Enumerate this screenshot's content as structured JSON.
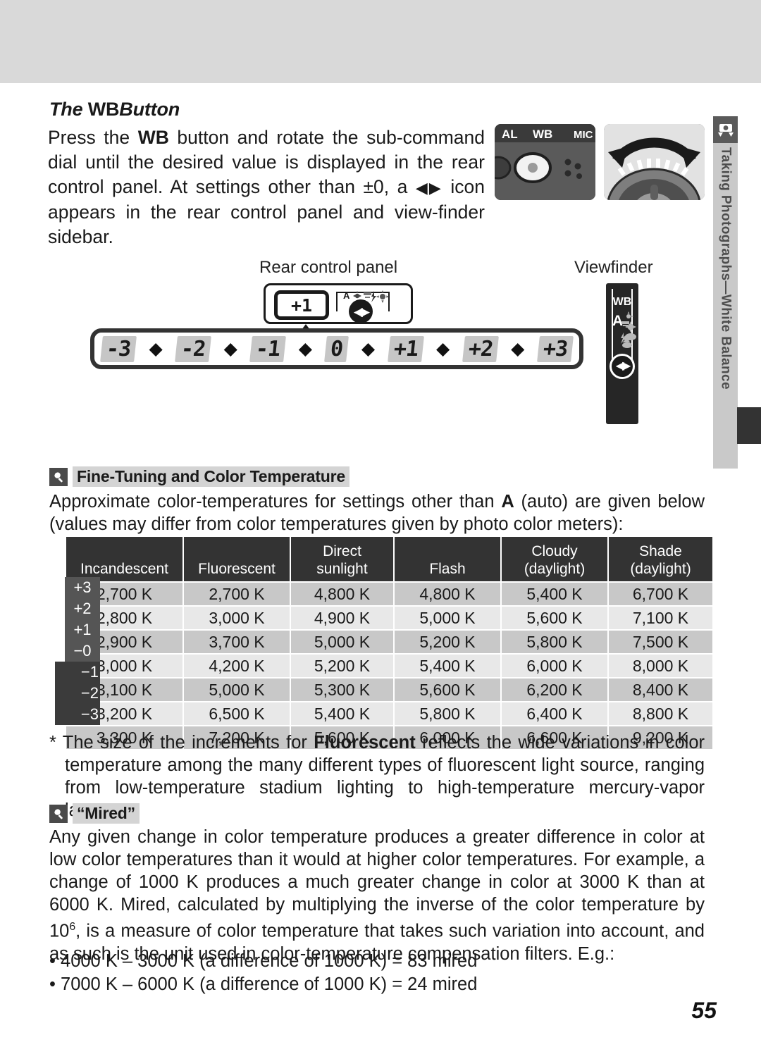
{
  "section_tab": {
    "label": "Taking Photographs—White Balance",
    "icon": "camera-icon"
  },
  "heading": {
    "the": "The ",
    "wb": "WB",
    "button": "Button"
  },
  "intro": {
    "text_1": "Press the ",
    "wb": "WB",
    "text_2": " button and rotate the sub-command dial until the desired value is displayed in the rear control panel.  At settings other than ±0, a ",
    "arrow_icon": "left-right-arrow-icon",
    "text_3": " icon appears in the rear control panel and view-finder sidebar."
  },
  "photos": [
    {
      "name": "wb-button-photo",
      "labels": [
        "AL",
        "WB",
        "MIC"
      ]
    },
    {
      "name": "sub-command-dial-photo",
      "labels": []
    }
  ],
  "diagram": {
    "rear_panel_caption": "Rear control panel",
    "viewfinder_caption": "Viewfinder",
    "rear_panel_value": "+1",
    "rear_panel_icon": "left-right-arrow-icon",
    "viewfinder_wb_label": "WB",
    "viewfinder_auto_label": "A",
    "viewfinder_icon": "left-right-arrow-icon",
    "scale_segments": [
      "-3",
      "-2",
      "-1",
      "0",
      "+1",
      "+2",
      "+3"
    ],
    "scale_diamond": "◆"
  },
  "note_fine_tuning": {
    "icon": "magnifier-icon",
    "title": "Fine-Tuning and Color Temperature",
    "body_1": "Approximate color-temperatures for settings other than ",
    "body_auto": "A",
    "body_2": " (auto) are given below (values may differ from color temperatures given by photo color meters):"
  },
  "table": {
    "row_labels": [
      "+3",
      "+2",
      "+1",
      "−0",
      "−1",
      "−2",
      "−3"
    ],
    "columns": [
      "Incandescent",
      "Fluorescent",
      "Direct sunlight",
      "Flash",
      "Cloudy (daylight)",
      "Shade (daylight)"
    ],
    "columns_top": [
      "",
      "",
      "Direct",
      "",
      "Cloudy",
      "Shade"
    ],
    "columns_bottom": [
      "Incandescent",
      "Fluorescent",
      "sunlight",
      "Flash",
      "(daylight)",
      "(daylight)"
    ],
    "rows": [
      [
        "2,700 K",
        "2,700 K",
        "4,800 K",
        "4,800 K",
        "5,400 K",
        "6,700 K"
      ],
      [
        "2,800 K",
        "3,000 K",
        "4,900 K",
        "5,000 K",
        "5,600 K",
        "7,100 K"
      ],
      [
        "2,900 K",
        "3,700 K",
        "5,000 K",
        "5,200 K",
        "5,800 K",
        "7,500 K"
      ],
      [
        "3,000 K",
        "4,200 K",
        "5,200 K",
        "5,400 K",
        "6,000 K",
        "8,000 K"
      ],
      [
        "3,100 K",
        "5,000 K",
        "5,300 K",
        "5,600 K",
        "6,200 K",
        "8,400 K"
      ],
      [
        "3,200 K",
        "6,500 K",
        "5,400 K",
        "5,800 K",
        "6,400 K",
        "8,800 K"
      ],
      [
        "3,300 K",
        "7,200 K",
        "5,600 K",
        "6,000 K",
        "6,600 K",
        "9,200 K"
      ]
    ]
  },
  "footnote": {
    "marker": "*",
    "text_1": " The size of the increments for ",
    "bold": "Fluorescent",
    "text_2": " reflects the wide variations in color temperature among the many different types of fluorescent light source, ranging from low-temperature stadium lighting to high-temperature mercury-vapor lamps."
  },
  "note_mired": {
    "icon": "magnifier-icon",
    "title": "“Mired”",
    "body_1": "Any given change in color temperature produces a greater difference in color at low color temperatures than it would at higher color temperatures.  For example, a change of 1000 K produces a much greater change in color at 3000 K than at 6000 K.  Mired, calculated by multiplying the inverse of the color temperature by 10",
    "exponent": "6",
    "body_2": ", is a measure of color temperature that takes such variation into account, and as such is the unit used in color-temperature compensation filters.  E.g.:",
    "bullets": [
      "• 4000 K – 3000 K (a difference of 1000 K) = 83 mired",
      "• 7000 K – 6000 K (a difference of 1000 K) = 24 mired"
    ]
  },
  "page_number": "55",
  "colors": {
    "band": "#d9d9d9",
    "tab": "#c9c9c9",
    "header_cell": "#333333",
    "row_odd": "#c8c8c8",
    "row_even": "#e8e8e8",
    "row_label": "#555555"
  }
}
